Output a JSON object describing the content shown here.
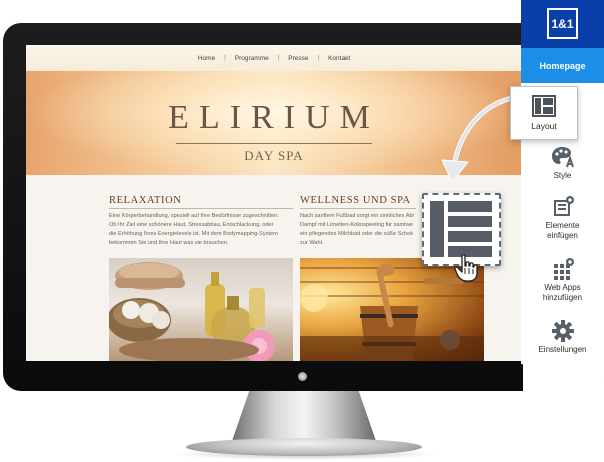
{
  "site": {
    "nav": [
      "Home",
      "Programme",
      "Presse",
      "Kontakt"
    ],
    "nav_separator": "|",
    "logo": "ELIRIUM",
    "tagline": "DAY SPA",
    "columns": [
      {
        "title": "RELAXATION",
        "lines": [
          "Eine Körperbehandlung, speziell auf Ihre Bedürfnisse zugeschnitten.",
          "Ob Ihr Ziel eine schönere Haut, Stressabbau, Entschlackung, oder",
          "die Erhöhung Ihres Energielevels ist. Mit dem Bodymapping-System",
          "bekommen Sie und Ihre Haut was sie brauchen."
        ]
      },
      {
        "title": "WELLNESS UND SPA",
        "lines": [
          "Nach sanftem Fußbad sorgt ein sinnliches Abl",
          "Dampf mit Limetten-Kokospeeling für samtwe",
          "ein pflegendes Milchbad oder die süße Schok",
          "zur Wahl."
        ]
      }
    ]
  },
  "toolbar": {
    "brand": "1&1",
    "homepage_tab": "Homepage",
    "layout_label": "Layout",
    "style_label": "Style",
    "elements_label": [
      "Elemente",
      "einfügen"
    ],
    "webapps_label": [
      "Web Apps",
      "hinzufügen"
    ],
    "settings_label": "Einstellungen"
  },
  "colors": {
    "brand_dark_blue": "#0a3ea8",
    "brand_light_blue": "#1b8ee8",
    "heading_brown": "#6b3d1f",
    "icon_gray": "#565d66"
  },
  "icons": {
    "layout": "layout-grid-icon",
    "style": "palette-icon",
    "elements": "insert-element-icon",
    "webapps": "app-grid-plus-icon",
    "settings": "gear-icon",
    "cursor": "hand-pointer-icon"
  }
}
